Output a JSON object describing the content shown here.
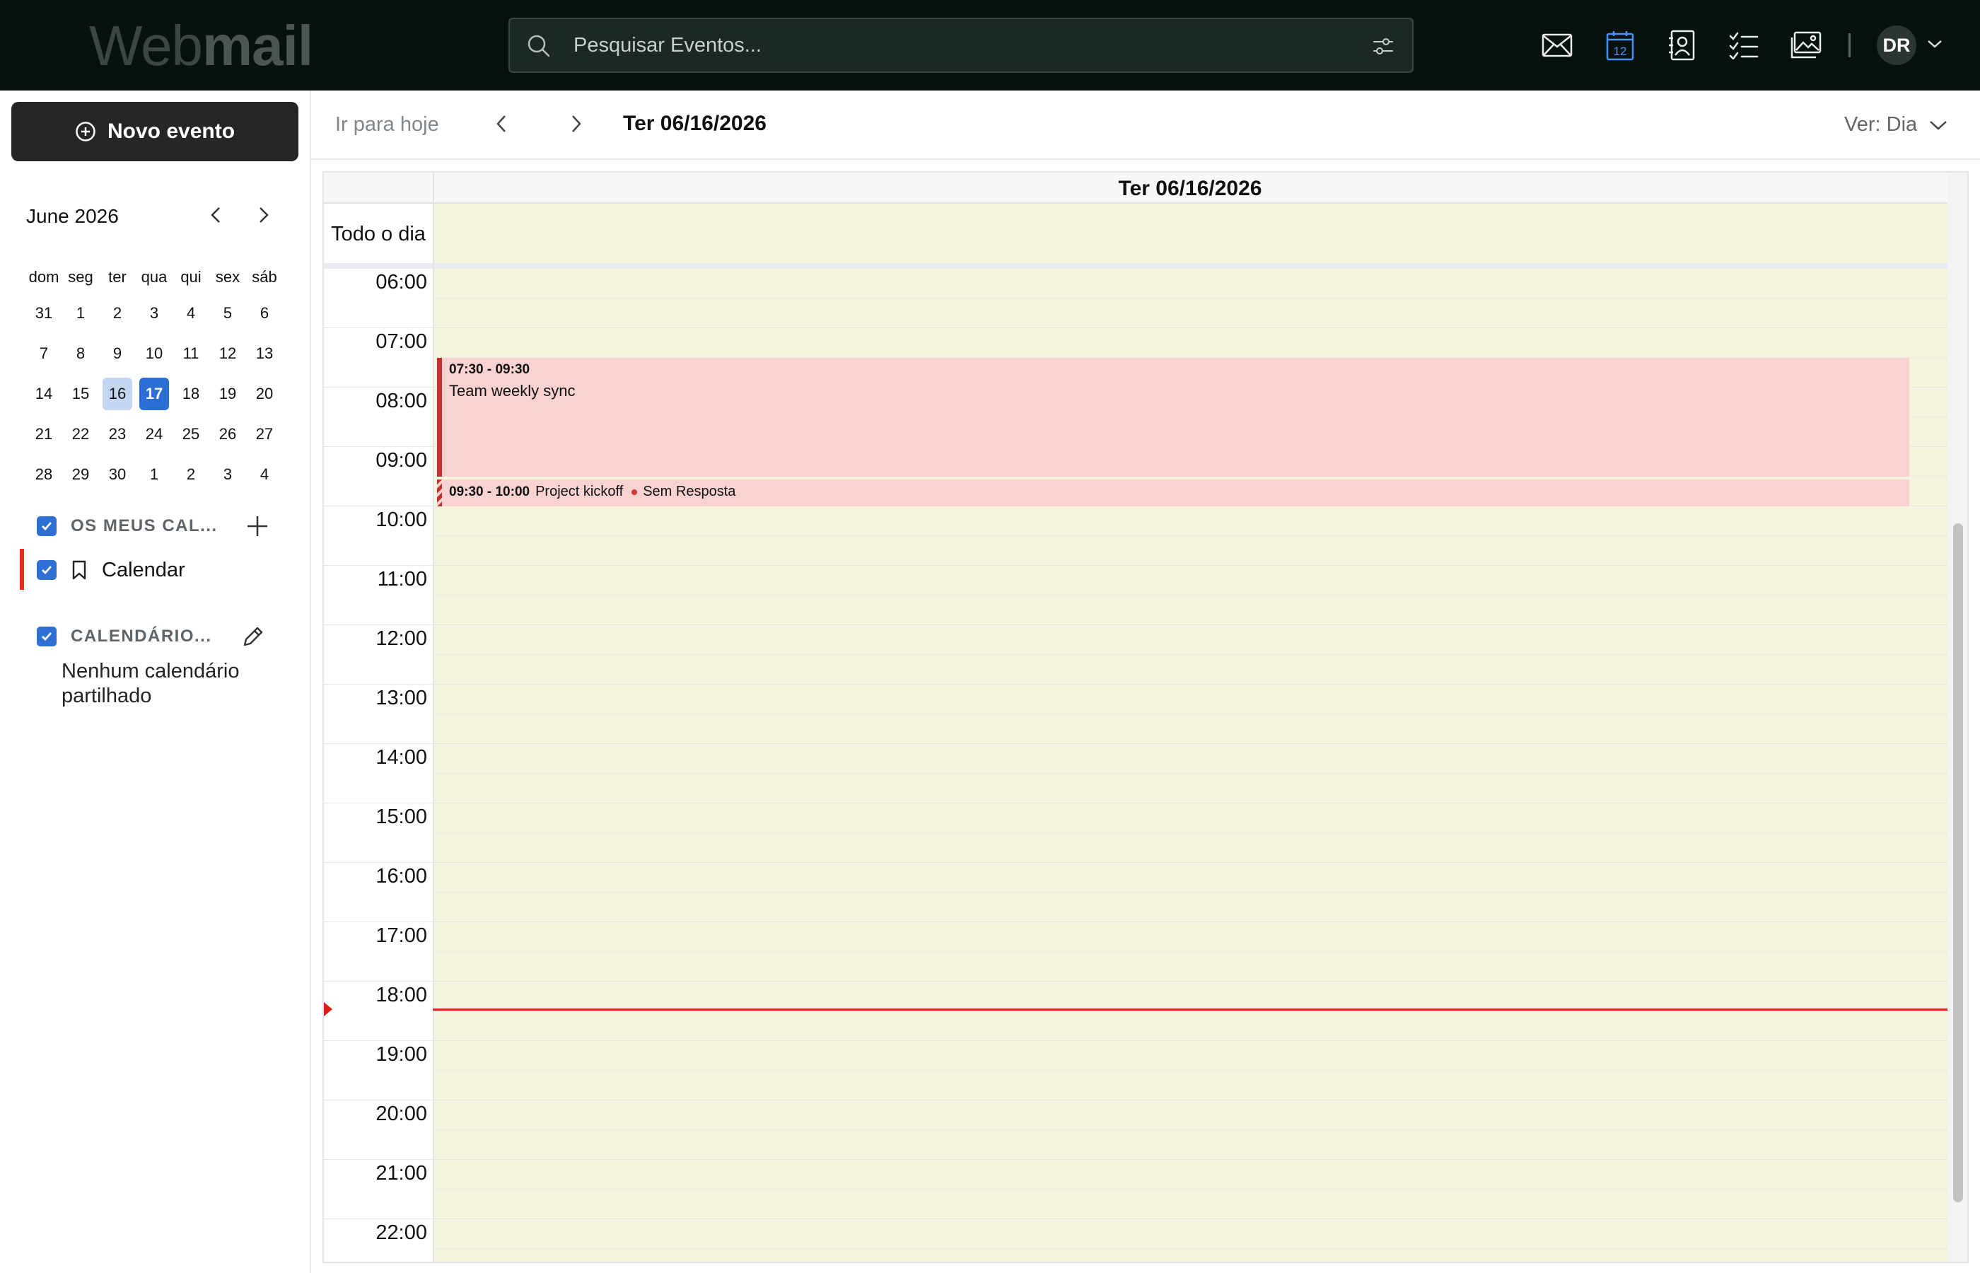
{
  "app": {
    "logo_light": "Web",
    "logo_bold": "mail"
  },
  "search": {
    "placeholder": "Pesquisar Eventos..."
  },
  "header_apps": [
    {
      "name": "mail-icon"
    },
    {
      "name": "calendar-icon",
      "badge": "12",
      "active": true
    },
    {
      "name": "contacts-icon"
    },
    {
      "name": "tasks-icon"
    },
    {
      "name": "photos-icon"
    }
  ],
  "user": {
    "initials": "DR"
  },
  "sidebar": {
    "new_event_label": "Novo evento",
    "mini_calendar": {
      "month_label": "June 2026",
      "weekdays": [
        "dom",
        "seg",
        "ter",
        "qua",
        "qui",
        "sex",
        "sáb"
      ],
      "weeks": [
        [
          "31",
          "1",
          "2",
          "3",
          "4",
          "5",
          "6"
        ],
        [
          "7",
          "8",
          "9",
          "10",
          "11",
          "12",
          "13"
        ],
        [
          "14",
          "15",
          "16",
          "17",
          "18",
          "19",
          "20"
        ],
        [
          "21",
          "22",
          "23",
          "24",
          "25",
          "26",
          "27"
        ],
        [
          "28",
          "29",
          "30",
          "1",
          "2",
          "3",
          "4"
        ]
      ],
      "selected_day": "16",
      "today_day": "17"
    },
    "my_calendars": {
      "label": "OS MEUS CAL...",
      "items": [
        {
          "label": "Calendar",
          "color": "#e3311d"
        }
      ]
    },
    "shared_calendars": {
      "label": "CALENDÁRIO...",
      "empty_text": "Nenhum calendário partilhado"
    }
  },
  "toolbar": {
    "today_label": "Ir para hoje",
    "current_date": "Ter 06/16/2026",
    "view_label": "Ver: Dia"
  },
  "day_view": {
    "column_header": "Ter 06/16/2026",
    "all_day_label": "Todo o dia",
    "hours": [
      "06:00",
      "07:00",
      "08:00",
      "09:00",
      "10:00",
      "11:00",
      "12:00",
      "13:00",
      "14:00",
      "15:00",
      "16:00",
      "17:00",
      "18:00",
      "19:00",
      "20:00",
      "21:00",
      "22:00"
    ],
    "events": [
      {
        "time": "07:30 - 09:30",
        "title": "Team weekly sync"
      },
      {
        "time": "09:30 - 10:00",
        "title": "Project kickoff",
        "status": "Sem Resposta"
      }
    ],
    "colors": {
      "day_background": "#f6f3de",
      "event_background": "#f8d3d1",
      "event_accent": "#c3302f",
      "now_line": "#d4271b"
    }
  }
}
